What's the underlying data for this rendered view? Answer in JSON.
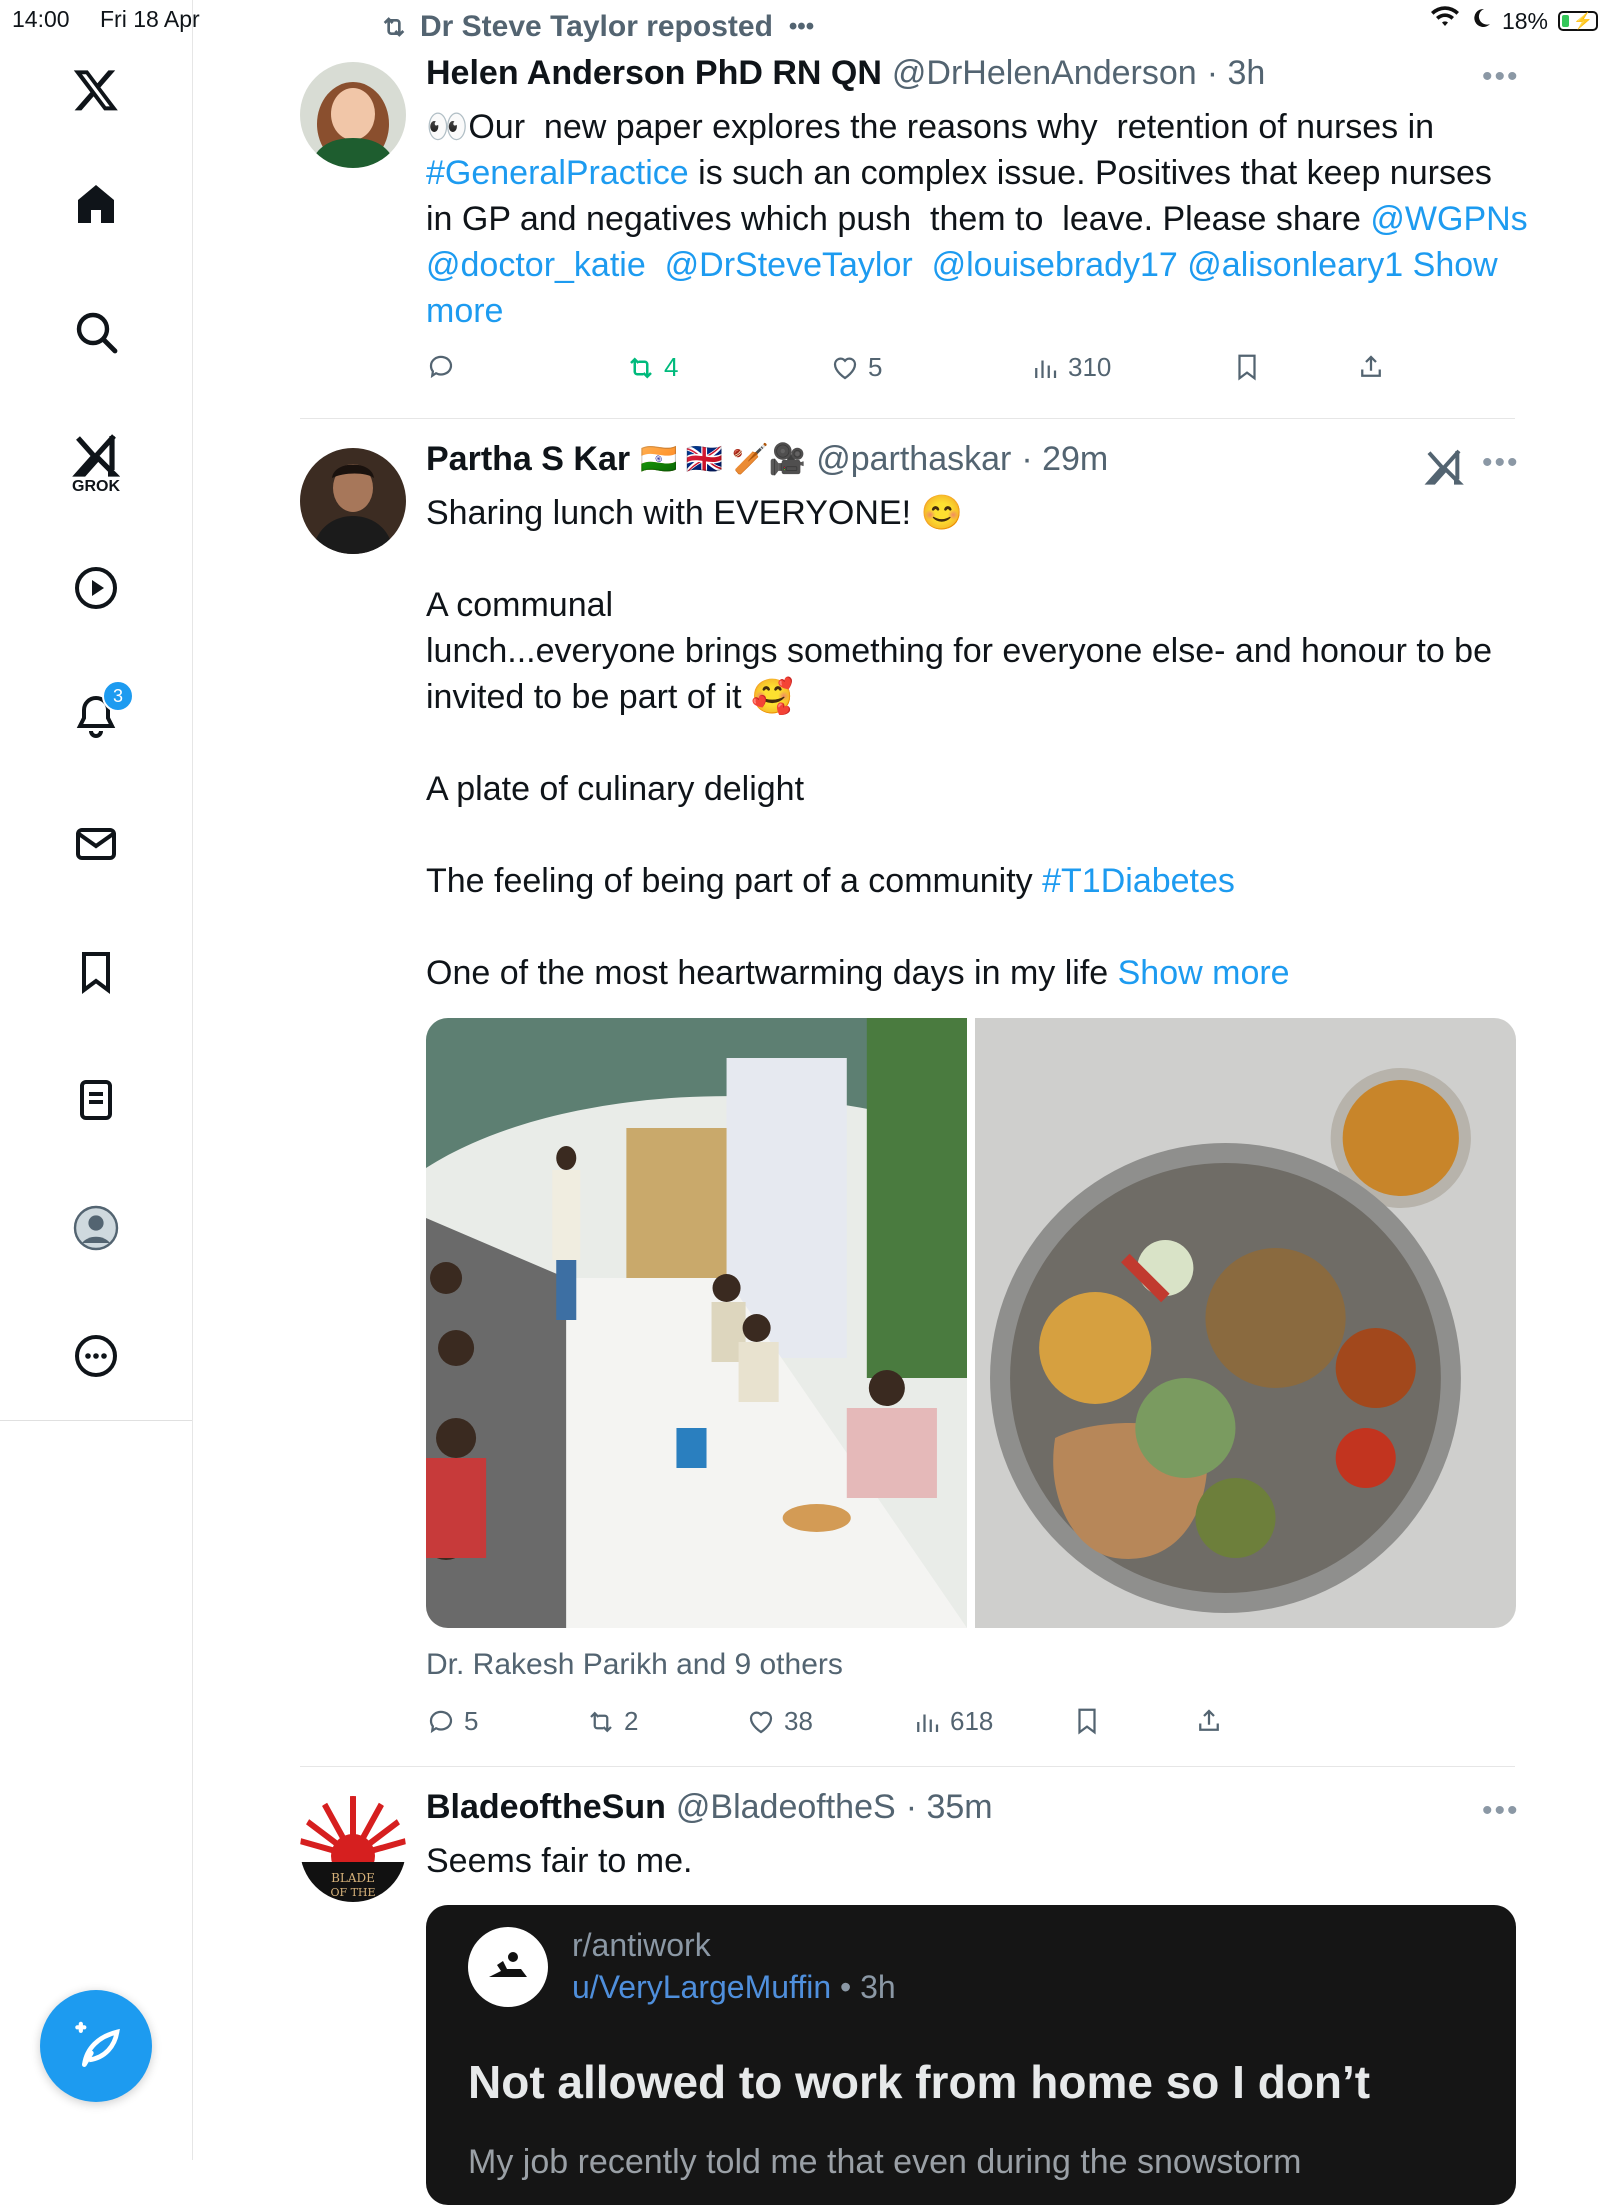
{
  "status_bar": {
    "time": "14:00",
    "date": "Fri 18 Apr",
    "battery": "18%"
  },
  "sidebar": {
    "grok_label": "GROK",
    "notifications_badge": "3",
    "items": [
      "x-logo",
      "home",
      "explore",
      "grok",
      "video",
      "notifications",
      "messages",
      "bookmarks",
      "lists",
      "profile",
      "more"
    ]
  },
  "repost": {
    "text": "Dr Steve Taylor reposted",
    "more": "•••"
  },
  "tweets": [
    {
      "name": "Helen Anderson PhD RN QN",
      "handle": "@DrHelenAnderson",
      "time": "· 3h",
      "lines": [
        {
          "parts": [
            {
              "t": "👀Our  new paper explores the reasons why  retention of nurses in"
            }
          ]
        },
        {
          "parts": [
            {
              "t": "#GeneralPractice",
              "link": true
            },
            {
              "t": " is such an complex issue. Positives that keep nurses"
            }
          ]
        },
        {
          "parts": [
            {
              "t": "in GP and negatives which push  them to  leave. Please share "
            },
            {
              "t": "@WGPNs",
              "link": true
            }
          ]
        },
        {
          "parts": [
            {
              "t": "@doctor_katie",
              "link": true
            },
            {
              "t": "  "
            },
            {
              "t": "@DrSteveTaylor",
              "link": true
            },
            {
              "t": "  "
            },
            {
              "t": "@louisebrady17",
              "link": true
            },
            {
              "t": " "
            },
            {
              "t": "@alisonleary1",
              "link": true
            },
            {
              "t": " "
            },
            {
              "t": "Show",
              "link": true
            }
          ]
        },
        {
          "parts": [
            {
              "t": "more",
              "link": true
            }
          ]
        }
      ],
      "reply_count": "",
      "retweets": "4",
      "likes": "5",
      "views": "310"
    },
    {
      "name": "Partha S Kar",
      "flags": "🇮🇳 🇬🇧 🏏🎥",
      "handle": "@parthaskar",
      "time": "· 29m",
      "lines": [
        {
          "parts": [
            {
              "t": "Sharing lunch with EVERYONE! 😊"
            }
          ]
        },
        {
          "parts": [
            {
              "t": ""
            }
          ]
        },
        {
          "parts": [
            {
              "t": "A communal"
            }
          ]
        },
        {
          "parts": [
            {
              "t": "lunch...everyone brings something for everyone else- and honour to be"
            }
          ]
        },
        {
          "parts": [
            {
              "t": "invited to be part of it 🥰"
            }
          ]
        },
        {
          "parts": [
            {
              "t": ""
            }
          ]
        },
        {
          "parts": [
            {
              "t": "A plate of culinary delight"
            }
          ]
        },
        {
          "parts": [
            {
              "t": ""
            }
          ]
        },
        {
          "parts": [
            {
              "t": "The feeling of being part of a community "
            },
            {
              "t": "#T1Diabetes",
              "link": true
            }
          ]
        },
        {
          "parts": [
            {
              "t": ""
            }
          ]
        },
        {
          "parts": [
            {
              "t": "One of the most heartwarming days in my life "
            },
            {
              "t": "Show more",
              "link": true
            }
          ]
        }
      ],
      "tagged": "Dr. Rakesh Parikh and 9 others",
      "replies": "5",
      "retweets": "2",
      "likes": "38",
      "views": "618"
    },
    {
      "name": "BladeoftheSun",
      "handle": "@BladeoftheS",
      "time": "· 35m",
      "text": "Seems fair to me.",
      "embed": {
        "subreddit": "r/antiwork",
        "user": "u/VeryLargeMuffin",
        "ago": " • 3h",
        "title": "Not allowed to work from home so I don’t",
        "next": "My job recently told me that even during the snowstorm"
      }
    }
  ],
  "colors": {
    "accent": "#1d9bf0",
    "retweet": "#00ba7c",
    "muted": "#536471"
  }
}
